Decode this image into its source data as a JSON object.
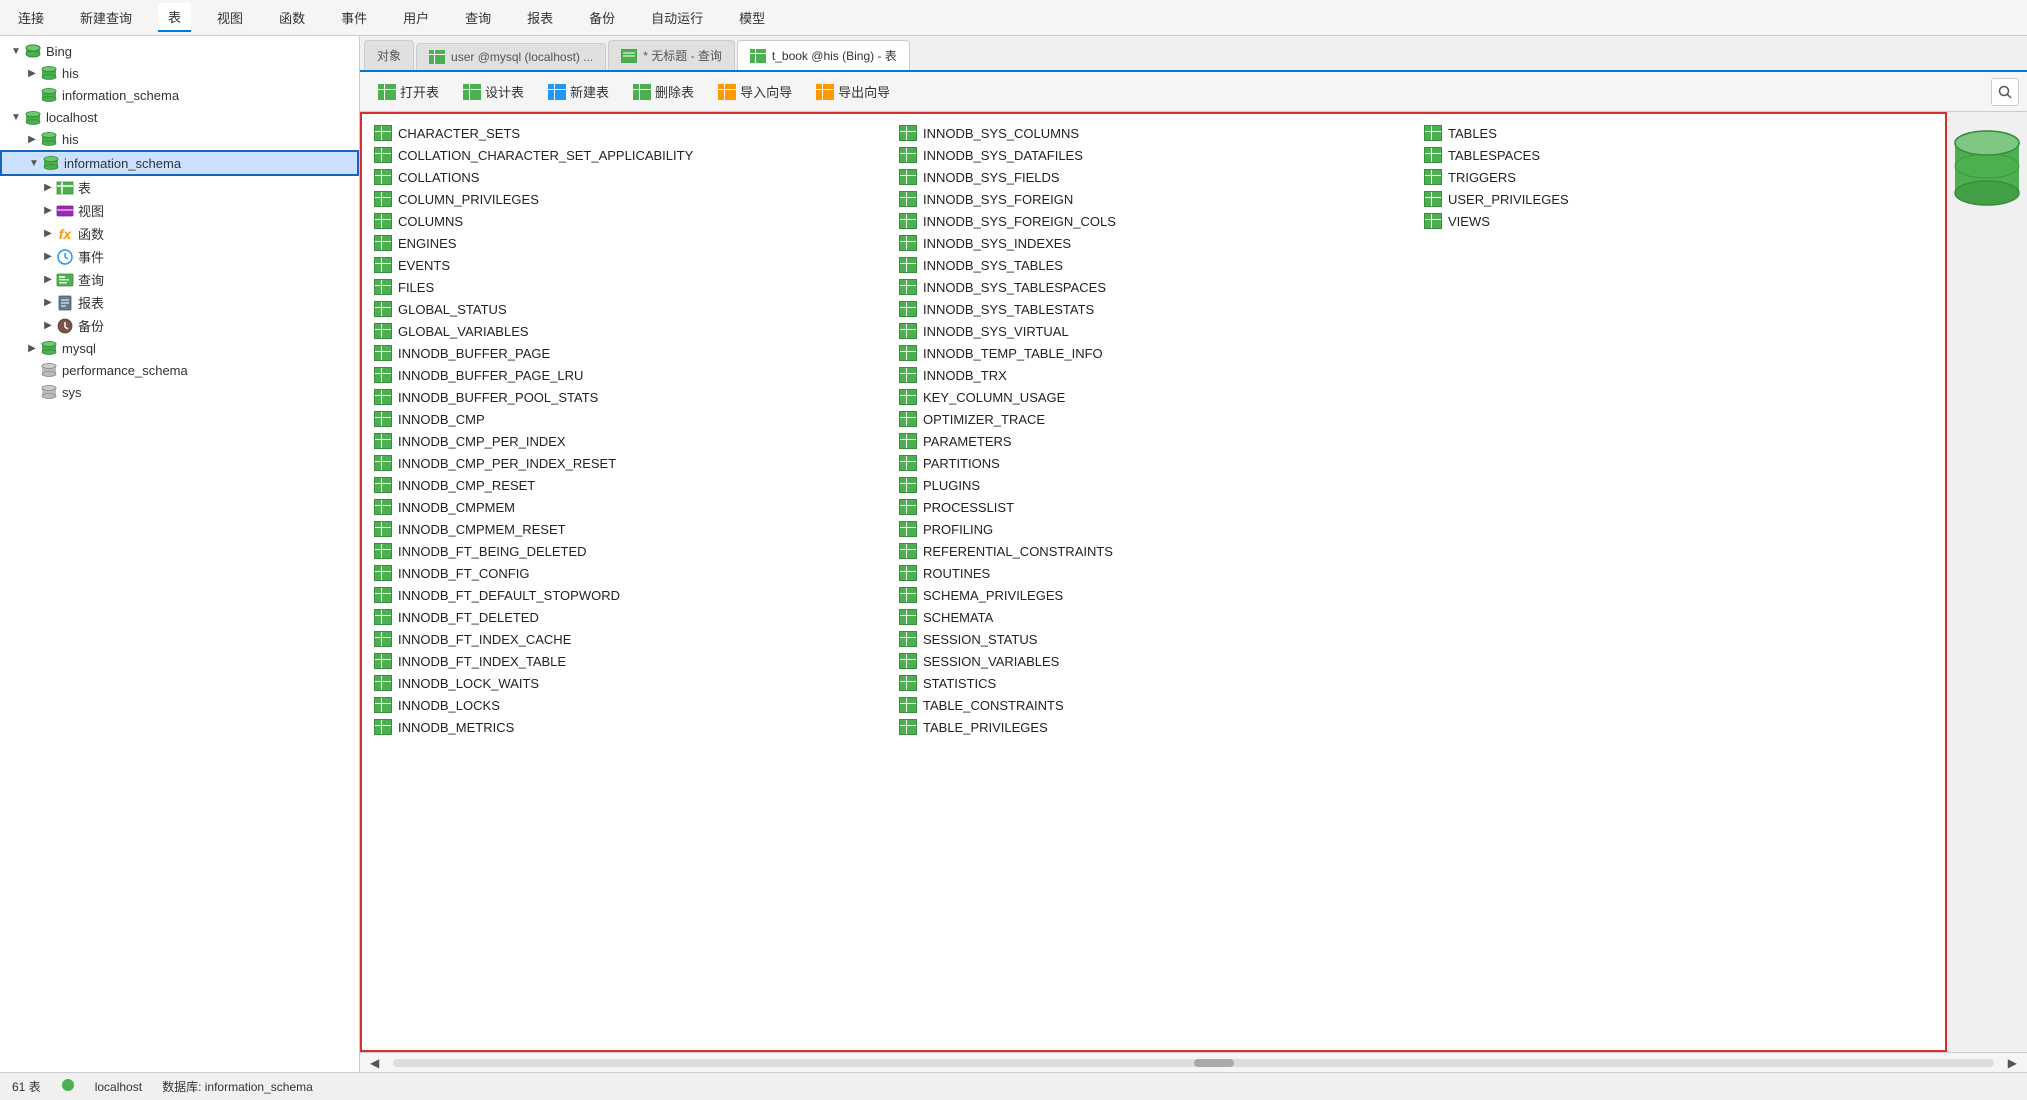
{
  "menuBar": {
    "items": [
      "连接",
      "新建查询",
      "表",
      "视图",
      "函数",
      "事件",
      "用户",
      "查询",
      "报表",
      "备份",
      "自动运行",
      "模型"
    ]
  },
  "tabs": [
    {
      "label": "对象",
      "type": "object",
      "active": false
    },
    {
      "label": "user @mysql (localhost) ...",
      "type": "table",
      "active": false
    },
    {
      "label": "* 无标题 - 查询",
      "type": "query",
      "active": false
    },
    {
      "label": "t_book @his (Bing) - 表",
      "type": "table",
      "active": true
    }
  ],
  "toolbar": {
    "buttons": [
      "打开表",
      "设计表",
      "新建表",
      "删除表",
      "导入向导",
      "导出向导"
    ]
  },
  "sidebar": {
    "connections": [
      {
        "name": "Bing",
        "type": "connection",
        "expanded": true,
        "children": [
          {
            "name": "his",
            "type": "db",
            "expanded": false
          },
          {
            "name": "information_schema",
            "type": "db",
            "expanded": false
          }
        ]
      },
      {
        "name": "localhost",
        "type": "connection",
        "expanded": true,
        "children": [
          {
            "name": "his",
            "type": "db",
            "expanded": false
          },
          {
            "name": "information_schema",
            "type": "db",
            "expanded": true,
            "selected": true,
            "children": [
              {
                "name": "表",
                "type": "folder-table",
                "expanded": false
              },
              {
                "name": "视图",
                "type": "folder-view",
                "expanded": false
              },
              {
                "name": "函数",
                "type": "folder-func",
                "expanded": false
              },
              {
                "name": "事件",
                "type": "folder-event",
                "expanded": false
              },
              {
                "name": "查询",
                "type": "folder-query",
                "expanded": false
              },
              {
                "name": "报表",
                "type": "folder-report",
                "expanded": false
              },
              {
                "name": "备份",
                "type": "folder-backup",
                "expanded": false
              }
            ]
          },
          {
            "name": "mysql",
            "type": "db",
            "expanded": false
          },
          {
            "name": "performance_schema",
            "type": "db-plain",
            "expanded": false
          },
          {
            "name": "sys",
            "type": "db-plain",
            "expanded": false
          }
        ]
      }
    ]
  },
  "tables": {
    "col1": [
      "CHARACTER_SETS",
      "COLLATION_CHARACTER_SET_APPLICABILITY",
      "COLLATIONS",
      "COLUMN_PRIVILEGES",
      "COLUMNS",
      "ENGINES",
      "EVENTS",
      "FILES",
      "GLOBAL_STATUS",
      "GLOBAL_VARIABLES",
      "INNODB_BUFFER_PAGE",
      "INNODB_BUFFER_PAGE_LRU",
      "INNODB_BUFFER_POOL_STATS",
      "INNODB_CMP",
      "INNODB_CMP_PER_INDEX",
      "INNODB_CMP_PER_INDEX_RESET",
      "INNODB_CMP_RESET",
      "INNODB_CMPMEM",
      "INNODB_CMPMEM_RESET",
      "INNODB_FT_BEING_DELETED",
      "INNODB_FT_CONFIG",
      "INNODB_FT_DEFAULT_STOPWORD",
      "INNODB_FT_DELETED",
      "INNODB_FT_INDEX_CACHE",
      "INNODB_FT_INDEX_TABLE",
      "INNODB_LOCK_WAITS",
      "INNODB_LOCKS",
      "INNODB_METRICS"
    ],
    "col2": [
      "INNODB_SYS_COLUMNS",
      "INNODB_SYS_DATAFILES",
      "INNODB_SYS_FIELDS",
      "INNODB_SYS_FOREIGN",
      "INNODB_SYS_FOREIGN_COLS",
      "INNODB_SYS_INDEXES",
      "INNODB_SYS_TABLES",
      "INNODB_SYS_TABLESPACES",
      "INNODB_SYS_TABLESTATS",
      "INNODB_SYS_VIRTUAL",
      "INNODB_TEMP_TABLE_INFO",
      "INNODB_TRX",
      "KEY_COLUMN_USAGE",
      "OPTIMIZER_TRACE",
      "PARAMETERS",
      "PARTITIONS",
      "PLUGINS",
      "PROCESSLIST",
      "PROFILING",
      "REFERENTIAL_CONSTRAINTS",
      "ROUTINES",
      "SCHEMA_PRIVILEGES",
      "SCHEMATA",
      "SESSION_STATUS",
      "SESSION_VARIABLES",
      "STATISTICS",
      "TABLE_CONSTRAINTS",
      "TABLE_PRIVILEGES"
    ],
    "col3": [
      "TABLES",
      "TABLESPACES",
      "TRIGGERS",
      "USER_PRIVILEGES",
      "VIEWS",
      "",
      "",
      "",
      "",
      "",
      "",
      "",
      "",
      "",
      "",
      "",
      "",
      "",
      "",
      "",
      "",
      "",
      "",
      "",
      "",
      "",
      "",
      ""
    ]
  },
  "statusBar": {
    "count": "61 表",
    "connection": "localhost",
    "database": "数据库: information_schema"
  }
}
